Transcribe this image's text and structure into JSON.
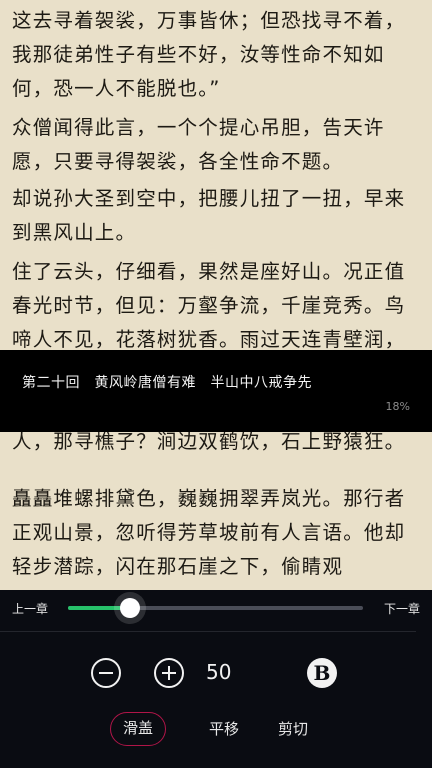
{
  "reader": {
    "paragraphs": [
      "这去寻着袈裟，万事皆休；但恐找寻不着，我那徒弟性子有些不好，汝等性命不知如何，恐一人不能脱也。”",
      "众僧闻得此言，一个个提心吊胆，告天许愿，只要寻得袈裟，各全性命不题。",
      "却说孙大圣到空中，把腰儿扭了一扭，早来到黑风山上。",
      "住了云头，仔细看，果然是座好山。况正值春光时节，但见：万壑争流，千崖竞秀。鸟啼人不见，花落树犹香。雨过天连青壁润，风来松卷翠屏张。山草发，野花开，悬崖峭嶂；薜萝生，佳木丽，峻岭平岗。不遇幽人，那寻樵子？涧边双鹤饮，石上野猿狂。",
      "矗矗堆螺排黛色，巍巍拥翠弄岚光。那行者正观山景，忽听得芳草坡前有人言语。他却轻步潜踪，闪在那石崖之下，偷睛观"
    ]
  },
  "chapter": {
    "title": "第二十回　黄风岭唐僧有难　半山中八戒争先",
    "progress_text": "18%"
  },
  "controls": {
    "prev_chapter_label": "上一章",
    "next_chapter_label": "下一章",
    "progress_fraction": 0.21,
    "font_size_value": "50",
    "icons": {
      "decrease": "minus-circle-icon",
      "increase": "plus-circle-icon",
      "bold": "bold-b-icon"
    },
    "page_modes": [
      {
        "label": "滑盖",
        "active": true
      },
      {
        "label": "平移",
        "active": false
      },
      {
        "label": "剪切",
        "active": false
      }
    ]
  },
  "colors": {
    "page_background": "#e9e0c9",
    "text": "#1d1a14",
    "panel_background": "#0a0c12",
    "slider_fill": "#27c26a",
    "active_mode_border": "#b01548"
  }
}
